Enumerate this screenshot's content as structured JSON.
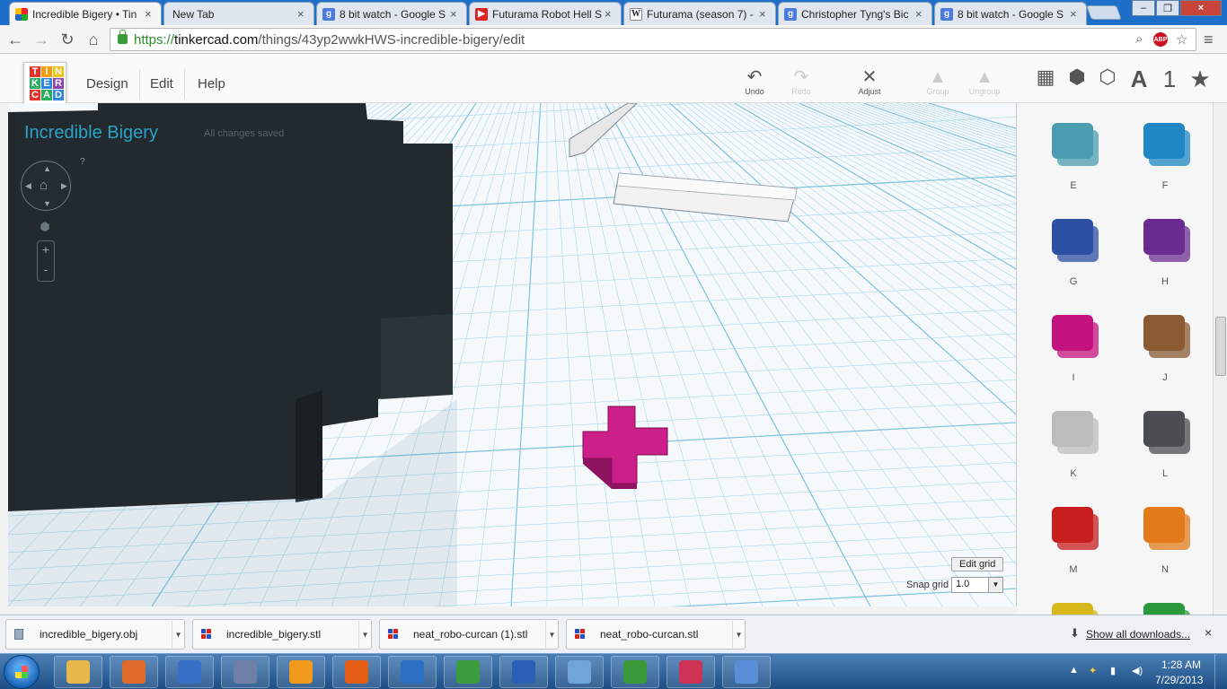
{
  "browser": {
    "tabs": [
      {
        "title": "Incredible Bigery • Tin",
        "icon": "tinkercad-favicon",
        "active": true
      },
      {
        "title": "New Tab",
        "icon": "none",
        "active": false
      },
      {
        "title": "8 bit watch - Google S",
        "icon": "google-favicon",
        "active": false
      },
      {
        "title": "Futurama Robot Hell S",
        "icon": "youtube-favicon",
        "active": false
      },
      {
        "title": "Futurama (season 7) -",
        "icon": "wikipedia-favicon",
        "active": false
      },
      {
        "title": "Christopher Tyng's Bic",
        "icon": "google-favicon",
        "active": false
      },
      {
        "title": "8 bit watch - Google S",
        "icon": "google-favicon",
        "active": false
      }
    ],
    "url": {
      "scheme": "https://",
      "host": "tinkercad.com",
      "path": "/things/43yp2wwkHWS-incredible-bigery/edit"
    },
    "extension_label": "ABP"
  },
  "app": {
    "logo_letters": [
      "T",
      "I",
      "N",
      "K",
      "E",
      "R",
      "C",
      "A",
      "D"
    ],
    "logo_colors": [
      "#e5332a",
      "#f39c12",
      "#f1c40f",
      "#27ae60",
      "#2e86de",
      "#8e44ad",
      "#e5332a",
      "#27ae60",
      "#2e86de"
    ],
    "menu": [
      "Design",
      "Edit",
      "Help"
    ],
    "tools": [
      {
        "label": "Undo",
        "enabled": true
      },
      {
        "label": "Redo",
        "enabled": false
      },
      {
        "label": "Adjust",
        "enabled": true
      },
      {
        "label": "Group",
        "enabled": false
      },
      {
        "label": "Ungroup",
        "enabled": false
      }
    ],
    "view_icons": [
      "grid-icon",
      "box-icon",
      "cylinder-icon",
      "text-icon",
      "number-icon",
      "star-icon"
    ],
    "view_glyph_text": "A",
    "view_glyph_number": "1"
  },
  "workplane": {
    "design_title": "Incredible Bigery",
    "save_status": "All changes saved",
    "help_mark": "?",
    "zoom_in": "+",
    "zoom_out": "-",
    "edit_grid_label": "Edit grid",
    "snap_grid_label": "Snap grid",
    "snap_grid_value": "1.0",
    "colors": {
      "grid_line": "#a9d6e8",
      "grid_major": "#7cc2dc",
      "dark_object": "#222a2f",
      "magenta_plus": "#cc1f8a",
      "white_bars": "#e8e8e8"
    }
  },
  "shapes": [
    {
      "label": "E",
      "color": "#4a9cb0"
    },
    {
      "label": "F",
      "color": "#1f87c4"
    },
    {
      "label": "G",
      "color": "#2c4fa3"
    },
    {
      "label": "H",
      "color": "#6a2d8f"
    },
    {
      "label": "I",
      "color": "#c4127f"
    },
    {
      "label": "J",
      "color": "#8a5a32"
    },
    {
      "label": "K",
      "color": "#bcbcbc"
    },
    {
      "label": "L",
      "color": "#4a4e52"
    },
    {
      "label": "M",
      "color": "#c81e1e"
    },
    {
      "label": "N",
      "color": "#e27b1a"
    },
    {
      "label": "",
      "color": "#d6b81a"
    },
    {
      "label": "",
      "color": "#2a9a3a"
    }
  ],
  "downloads": {
    "items": [
      "incredible_bigery.obj",
      "incredible_bigery.stl",
      "neat_robo-curcan (1).stl",
      "neat_robo-curcan.stl"
    ],
    "show_all": "Show all downloads...",
    "close": "×"
  },
  "taskbar": {
    "apps": [
      {
        "name": "explorer",
        "color": "#e8b84a"
      },
      {
        "name": "app-orange",
        "color": "#e06a2a"
      },
      {
        "name": "app-wizard",
        "color": "#3a6fc8"
      },
      {
        "name": "app-tools",
        "color": "#6f7fa8"
      },
      {
        "name": "media-player",
        "color": "#f29a1a"
      },
      {
        "name": "firefox",
        "color": "#e35d14"
      },
      {
        "name": "notepad-writer",
        "color": "#2b6fc2"
      },
      {
        "name": "chrome",
        "color": "#3b9c3b"
      },
      {
        "name": "word-doc",
        "color": "#2b5fb5"
      },
      {
        "name": "paint",
        "color": "#6ea6d8"
      },
      {
        "name": "utorrent",
        "color": "#3a9a3a"
      },
      {
        "name": "tinkercad-app",
        "color": "#cc3355"
      },
      {
        "name": "app-x",
        "color": "#5a8fd8"
      }
    ],
    "time": "1:28 AM",
    "date": "7/29/2013"
  }
}
